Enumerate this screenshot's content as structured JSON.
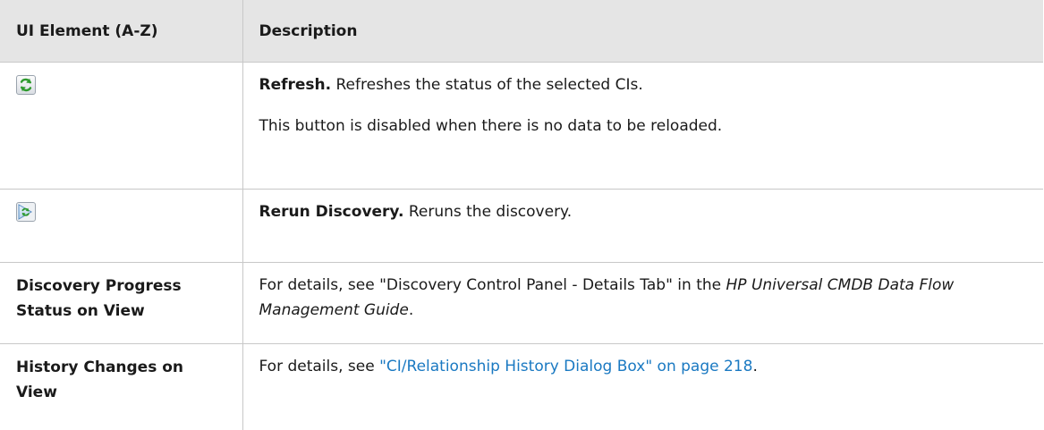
{
  "header": {
    "col_element": "UI Element (A-Z)",
    "col_description": "Description"
  },
  "rows": [
    {
      "icon": "refresh-icon",
      "term": "Refresh.",
      "text": " Refreshes the status of the selected CIs.",
      "note": "This button is disabled when there is no data to be reloaded."
    },
    {
      "icon": "rerun-discovery-icon",
      "term": "Rerun Discovery.",
      "text": " Reruns the discovery."
    },
    {
      "element": "Discovery Progress Status on View",
      "text_before": "For details, see \"Discovery Control Panel - Details Tab\" in the ",
      "guide": "HP Universal CMDB Data Flow Management Guide",
      "text_after": "."
    },
    {
      "element": "History Changes on View",
      "text_before": "For details, see ",
      "link": "\"CI/Relationship History Dialog Box\" on page 218",
      "text_after": "."
    }
  ],
  "colors": {
    "header_bg": "#e5e5e5",
    "border": "#c8c8c8",
    "link": "#1a79c2",
    "icon_green": "#3aa63a",
    "icon_blue": "#5b9bd5"
  }
}
